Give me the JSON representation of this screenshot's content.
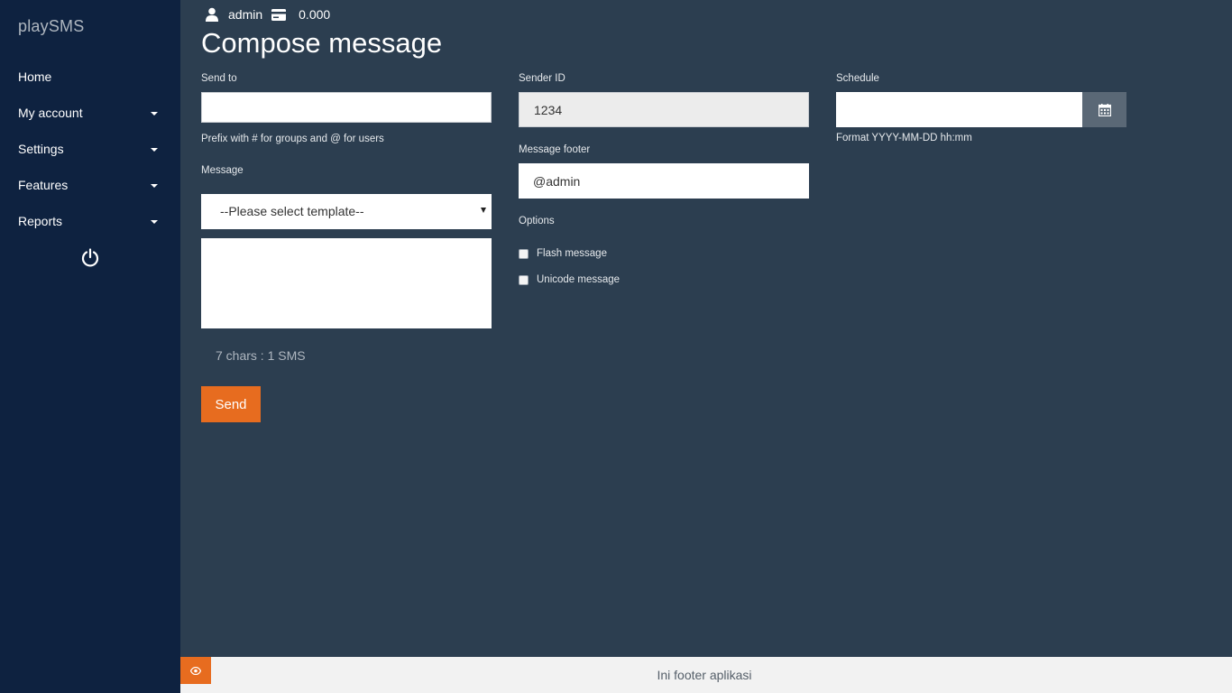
{
  "app": {
    "brand": "playSMS"
  },
  "sidebar": {
    "items": [
      {
        "label": "Home",
        "has_caret": false
      },
      {
        "label": "My account",
        "has_caret": true
      },
      {
        "label": "Settings",
        "has_caret": true
      },
      {
        "label": "Features",
        "has_caret": true
      },
      {
        "label": "Reports",
        "has_caret": true
      }
    ],
    "logout_icon": "power-icon"
  },
  "topbar": {
    "username": "admin",
    "credit": "0.000",
    "user_icon": "user-icon",
    "credit_icon": "credit-card-icon"
  },
  "page": {
    "title": "Compose message"
  },
  "form": {
    "send_to": {
      "label": "Send to",
      "value": "",
      "help": "Prefix with # for groups and @ for users"
    },
    "message": {
      "label": "Message",
      "template_selected": "--Please select template--",
      "value": "",
      "counter": "7 chars : 1 SMS"
    },
    "sender_id": {
      "label": "Sender ID",
      "value": "1234"
    },
    "footer": {
      "label": "Message footer",
      "value": "@admin"
    },
    "options": {
      "label": "Options",
      "flash": {
        "label": "Flash message",
        "checked": false
      },
      "unicode": {
        "label": "Unicode message",
        "checked": false
      }
    },
    "schedule": {
      "label": "Schedule",
      "value": "",
      "help": "Format YYYY-MM-DD hh:mm",
      "button_icon": "calendar-icon"
    },
    "send_label": "Send"
  },
  "footer": {
    "text": "Ini footer aplikasi",
    "toggle_icon": "eye-icon"
  },
  "colors": {
    "sidebar_bg": "#0e2240",
    "main_bg": "#2c3e50",
    "accent": "#e76c1f",
    "footer_bg": "#f2f2f2"
  }
}
